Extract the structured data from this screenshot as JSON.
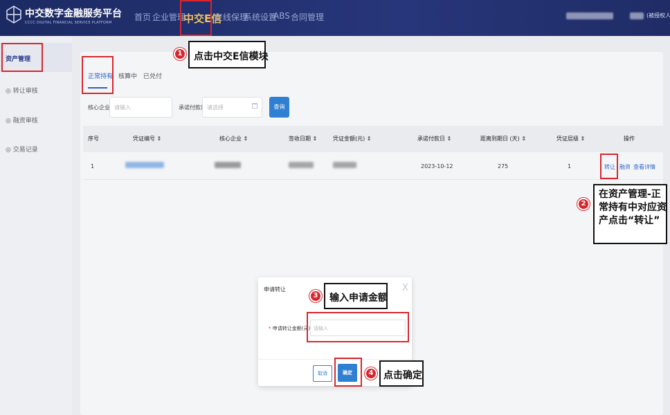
{
  "brand": {
    "title": "中交数字金融服务平台",
    "subtitle": "CCCC DIGITAL FINANCIAL SERVICE PLATFORM"
  },
  "nav": {
    "items": [
      "首页",
      "企业管理",
      "中交E信",
      "在线保理",
      "系统设置",
      "ABS",
      "合同管理"
    ]
  },
  "user": {
    "role": "(被授权人)"
  },
  "sidebar": {
    "items": [
      "资产管理",
      "转让审核",
      "融资审核",
      "交易记录"
    ]
  },
  "tabs": [
    "正常持有",
    "核算中",
    "已兑付"
  ],
  "filters": {
    "core_label": "核心企业",
    "core_placeholder": "请输入",
    "date_label": "承诺付款日",
    "date_placeholder": "请选择",
    "search_label": "查询"
  },
  "table": {
    "headers": [
      "序号",
      "凭证编号 ⇕",
      "核心企业 ⇕",
      "签收日期 ⇕",
      "凭证金额(元) ⇕",
      "承诺付款日 ⇕",
      "距离到期日 (天) ⇕",
      "凭证层级 ⇕",
      "操作"
    ],
    "rows": [
      {
        "index": "1",
        "date": "2023-10-12",
        "days": "275",
        "level": "1",
        "ops": [
          "转让",
          "融资",
          "查看详情"
        ]
      }
    ]
  },
  "dialog": {
    "title": "申请转让",
    "close": "X",
    "field_required": "*",
    "field_label": "申请转让金额(元)",
    "field_placeholder": "请输入",
    "cancel": "取消",
    "confirm": "确定"
  },
  "annotations": [
    {
      "num": "1",
      "text": "点击中交E信模块"
    },
    {
      "num": "2",
      "text": "在资产管理-正\n常持有中对应资\n产点击“转让”"
    },
    {
      "num": "3",
      "text": "输入申请金额"
    },
    {
      "num": "4",
      "text": "点击确定"
    }
  ],
  "colors": {
    "header_bg": "#1f2c66",
    "accent": "#2f7fd3",
    "highlight": "#d7262d",
    "active_nav": "#f1c25a"
  }
}
